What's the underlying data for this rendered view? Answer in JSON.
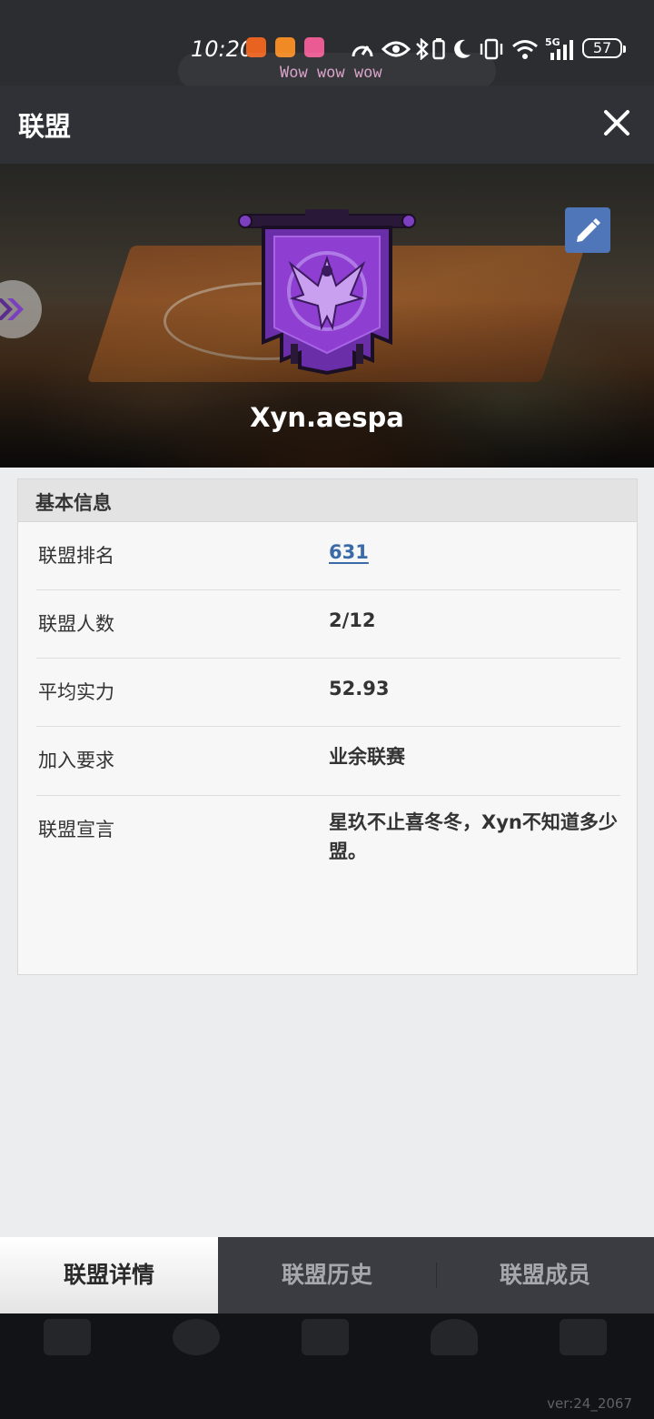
{
  "status_bar": {
    "time": "10:20",
    "lyric": "Wow wow wow",
    "battery": "57",
    "network": "5G",
    "icons": [
      "app-icon",
      "heart-app-icon",
      "bilibili-icon",
      "speed-icon",
      "eye-icon",
      "bluetooth-icon",
      "moon-icon",
      "vibrate-icon",
      "wifi-icon",
      "signal-icon",
      "battery-icon"
    ]
  },
  "header": {
    "title": "联盟",
    "close_icon": "close-icon"
  },
  "banner": {
    "team_name": "Xyn.aespa",
    "emblem_icon": "phoenix-banner-emblem",
    "edit_icon": "pencil-icon",
    "side_icon": "double-chevron-icon"
  },
  "info": {
    "heading": "基本信息",
    "rows": [
      {
        "label": "联盟排名",
        "value": "631"
      },
      {
        "label": "联盟人数",
        "value": "2/12"
      },
      {
        "label": "平均实力",
        "value": "52.93"
      },
      {
        "label": "加入要求",
        "value": "业余联赛"
      },
      {
        "label": "联盟宣言",
        "value": "星玖不止喜冬冬，Xyn不知道多少盟。"
      }
    ]
  },
  "tabs": [
    {
      "label": "联盟详情",
      "active": true
    },
    {
      "label": "联盟历史",
      "active": false
    },
    {
      "label": "联盟成员",
      "active": false
    }
  ],
  "footer": {
    "version": "ver:24_2067"
  },
  "colors": {
    "link": "#3a6aa8",
    "edit_button": "#4f76b8",
    "emblem_purple": "#8e3fd1"
  }
}
